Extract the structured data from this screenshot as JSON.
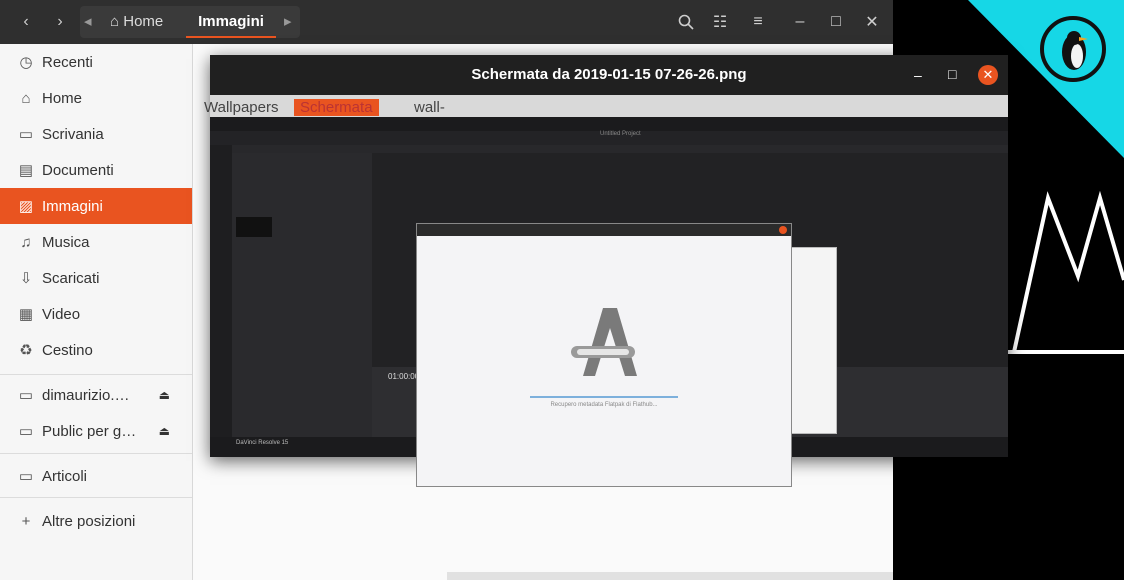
{
  "files": {
    "breadcrumb": {
      "home": "Home",
      "current": "Immagini"
    },
    "sidebar": {
      "items": [
        {
          "label": "Recenti",
          "icon": "clock-icon"
        },
        {
          "label": "Home",
          "icon": "home-icon"
        },
        {
          "label": "Scrivania",
          "icon": "desktop-icon"
        },
        {
          "label": "Documenti",
          "icon": "document-icon"
        },
        {
          "label": "Immagini",
          "icon": "image-icon",
          "active": true
        },
        {
          "label": "Musica",
          "icon": "music-icon"
        },
        {
          "label": "Scaricati",
          "icon": "download-icon"
        },
        {
          "label": "Video",
          "icon": "video-icon"
        },
        {
          "label": "Cestino",
          "icon": "trash-icon"
        }
      ],
      "mounts": [
        {
          "label": "dimaurizio.…",
          "icon": "network-drive-icon"
        },
        {
          "label": "Public per g…",
          "icon": "folder-icon"
        }
      ],
      "bookmarks": [
        {
          "label": "Articoli",
          "icon": "folder-icon"
        }
      ],
      "other": {
        "label": "Altre posizioni"
      }
    }
  },
  "viewer": {
    "title": "Schermata da 2019-01-15 07-26-26.png",
    "tags": {
      "wallpapers": "Wallpapers",
      "schermata": "Schermata",
      "wall": "wall-"
    }
  },
  "resolve": {
    "timecode": "01:00:00",
    "project": "Untitled Project",
    "bottom_label": "DaVinci Resolve 15",
    "dialog_message": "Recupero metadata Flatpak di Flathub..."
  },
  "colors": {
    "accent": "#e95420",
    "teal": "#16d7e6"
  }
}
